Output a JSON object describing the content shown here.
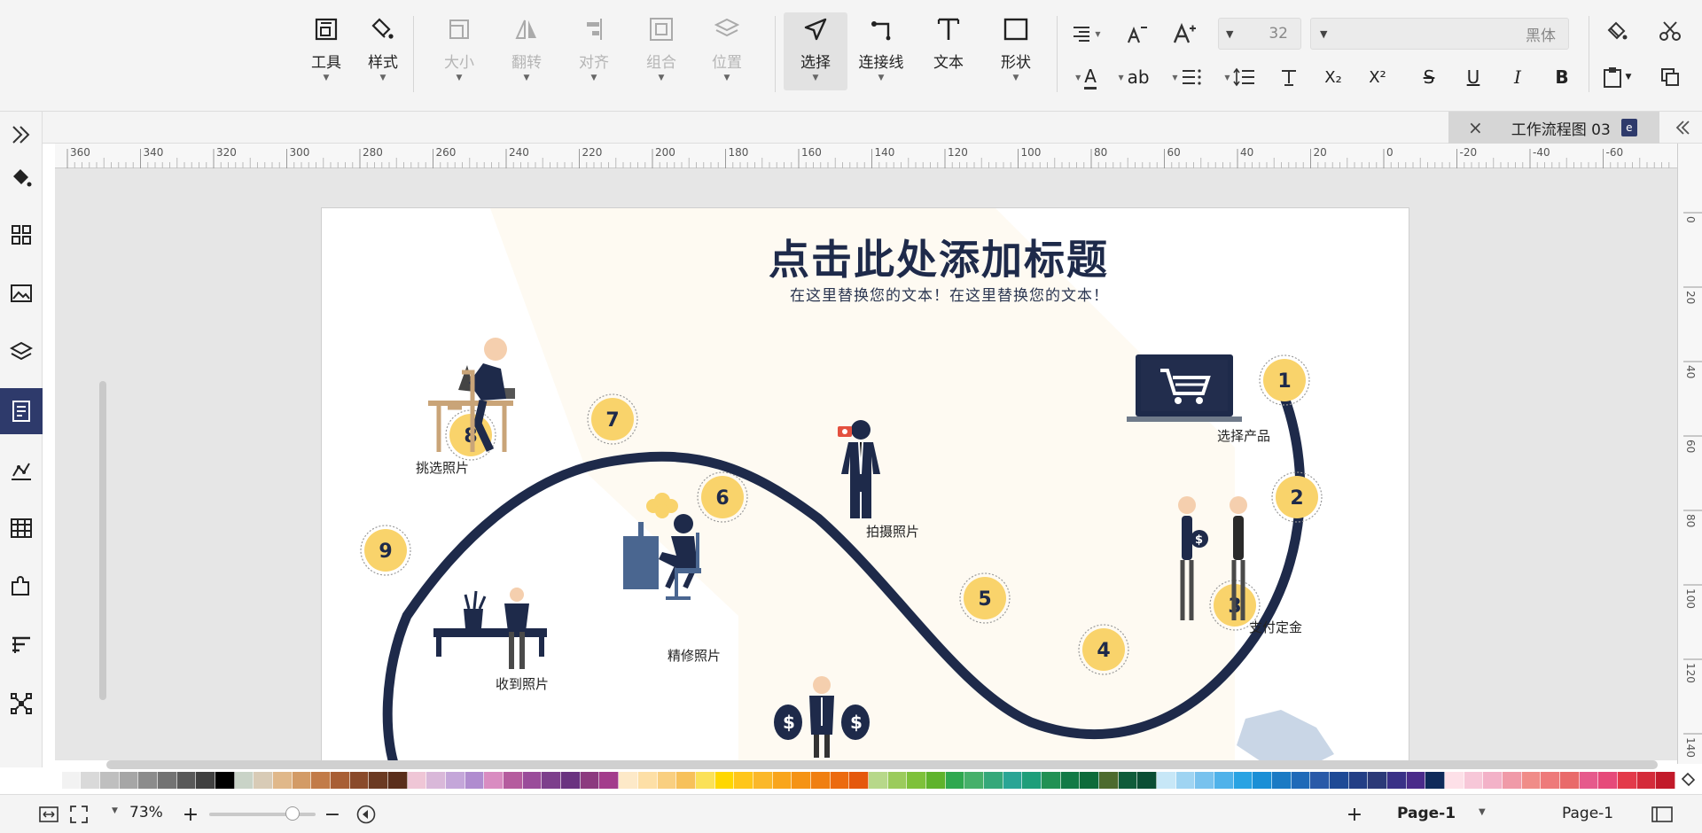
{
  "toolbar": {
    "font_name_placeholder": "黑体",
    "font_size": "32",
    "big": {
      "tools": "工具",
      "style": "样式",
      "size": "大小",
      "flip": "翻转",
      "align": "对齐",
      "group": "组合",
      "position": "位置",
      "select": "选择",
      "connector": "连接线",
      "text": "文本",
      "shape": "形状"
    },
    "bold": "B",
    "italic": "I",
    "underline": "U",
    "strike": "S",
    "text_a": "A",
    "ab": "ab",
    "sup": "X²",
    "sub": "X₂",
    "grow_a": "A⁺",
    "shrink_a": "A⁻"
  },
  "tab": {
    "title": "工作流程图 03",
    "close": "×"
  },
  "ruler": {
    "h_ticks": [
      "360",
      "340",
      "320",
      "300",
      "280",
      "260",
      "240",
      "220",
      "200",
      "180",
      "160",
      "140",
      "120",
      "100",
      "80",
      "60",
      "40",
      "20",
      "0",
      "-20",
      "-40",
      "-60"
    ],
    "v_ticks": [
      "0",
      "20",
      "40",
      "60",
      "80",
      "100",
      "120",
      "140"
    ]
  },
  "diagram": {
    "title": "点击此处添加标题",
    "subtitle": "在这里替换您的文本！在这里替换您的文本！",
    "steps": [
      {
        "n": "1",
        "label": "选择产品"
      },
      {
        "n": "2",
        "label": "支付定金"
      },
      {
        "n": "3",
        "label": ""
      },
      {
        "n": "4",
        "label": ""
      },
      {
        "n": "5",
        "label": ""
      },
      {
        "n": "6",
        "label": "拍摄照片"
      },
      {
        "n": "7",
        "label": "精修照片"
      },
      {
        "n": "8",
        "label": "挑选照片"
      },
      {
        "n": "9",
        "label": "收到照片"
      }
    ],
    "colors": {
      "path": "#1e2a4a",
      "circle": "#f9d36b",
      "figure": "#1e2a4a",
      "skin": "#f5cfae",
      "wood": "#c9a478"
    }
  },
  "status": {
    "zoom": "73%",
    "page_tab": "Page-1",
    "page_name": "Page-1",
    "add": "+"
  },
  "palette": [
    "#ffffff",
    "#f2f2f2",
    "#d9d9d9",
    "#bfbfbf",
    "#a6a6a6",
    "#8c8c8c",
    "#737373",
    "#595959",
    "#404040",
    "#000000",
    "#c9d3c7",
    "#d8cbb6",
    "#e0b88a",
    "#d39b66",
    "#c27b48",
    "#a85e34",
    "#8a4a2a",
    "#6b3a22",
    "#5a2e1b",
    "#efc6d6",
    "#d9b8d9",
    "#c4a6d9",
    "#b08ccf",
    "#d98cc1",
    "#b55c9e",
    "#9a4c9a",
    "#7d3f8c",
    "#6a3380",
    "#8c3a7f",
    "#a33c8c",
    "#fde9c8",
    "#fddfa6",
    "#f9cf80",
    "#f7c15a",
    "#fbe158",
    "#ffd700",
    "#ffc61a",
    "#fbb829",
    "#f9a51b",
    "#f59315",
    "#f07f11",
    "#ec6a0f",
    "#e5580c",
    "#b7d88a",
    "#9bcb5c",
    "#7ec13a",
    "#5fb32c",
    "#2fa84f",
    "#46b06a",
    "#35a87a",
    "#2aa595",
    "#1e9e7a",
    "#219154",
    "#127a46",
    "#0d6b3a",
    "#4d6b2e",
    "#0f5c3a",
    "#0a4e34",
    "#c7e7f7",
    "#9fd4f2",
    "#78c2ee",
    "#4fb2ea",
    "#29a3e3",
    "#1a8fd6",
    "#1a7ac4",
    "#1f6ab8",
    "#2a5aa8",
    "#1e4a96",
    "#233f86",
    "#2c3a78",
    "#3a3187",
    "#4a2b8a",
    "#0f2a5a",
    "#fde0e8",
    "#f7c7d8",
    "#f3b2c8",
    "#f09aa8",
    "#f08c88",
    "#ee7a7a",
    "#e96a6a",
    "#e65a8c",
    "#e64a7a",
    "#e33a4a",
    "#d42b3a",
    "#c21a2a"
  ]
}
